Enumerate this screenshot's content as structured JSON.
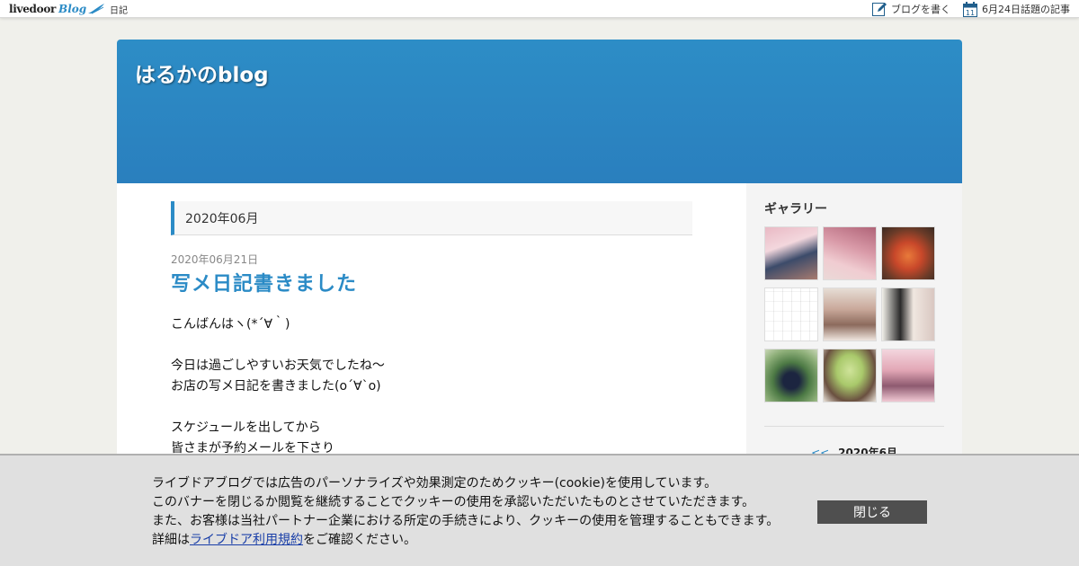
{
  "topbar": {
    "logo_word": "livedoor",
    "logo_blog": "Blog",
    "category": "日記",
    "write_link": "ブログを書く",
    "calendar_day": "11",
    "topic_link": "6月24日話題の記事"
  },
  "header": {
    "blog_title": "はるかのblog"
  },
  "main": {
    "month_heading": "2020年06月",
    "entry": {
      "date": "2020年06月21日",
      "title": "写メ日記書きました",
      "lines": [
        "こんばんはヽ(*´∀｀)",
        "",
        "今日は過ごしやすいお天気でしたね〜",
        "お店の写メ日記を書きました(o´∀`o)",
        "",
        "スケジュールを出してから",
        "皆さまが予約メールを下さり"
      ]
    }
  },
  "sidebar": {
    "gallery_title": "ギャラリー",
    "calendar_prev": "<<",
    "calendar_month": "2020年6月"
  },
  "cookie": {
    "line1": "ライブドアブログでは広告のパーソナライズや効果測定のためクッキー(cookie)を使用しています。",
    "line2": "このバナーを閉じるか閲覧を継続することでクッキーの使用を承認いただいたものとさせていただきます。",
    "line3": "また、お客様は当社パートナー企業における所定の手続きにより、クッキーの使用を管理することもできます。",
    "line4_prefix": "詳細は",
    "line4_link": "ライブドア利用規約",
    "line4_suffix": "をご確認ください。",
    "close_label": "閉じる"
  },
  "colors": {
    "accent": "#2b8bc6",
    "header_bg": "#2d8dc6",
    "close_button": "#4f4f4f"
  }
}
